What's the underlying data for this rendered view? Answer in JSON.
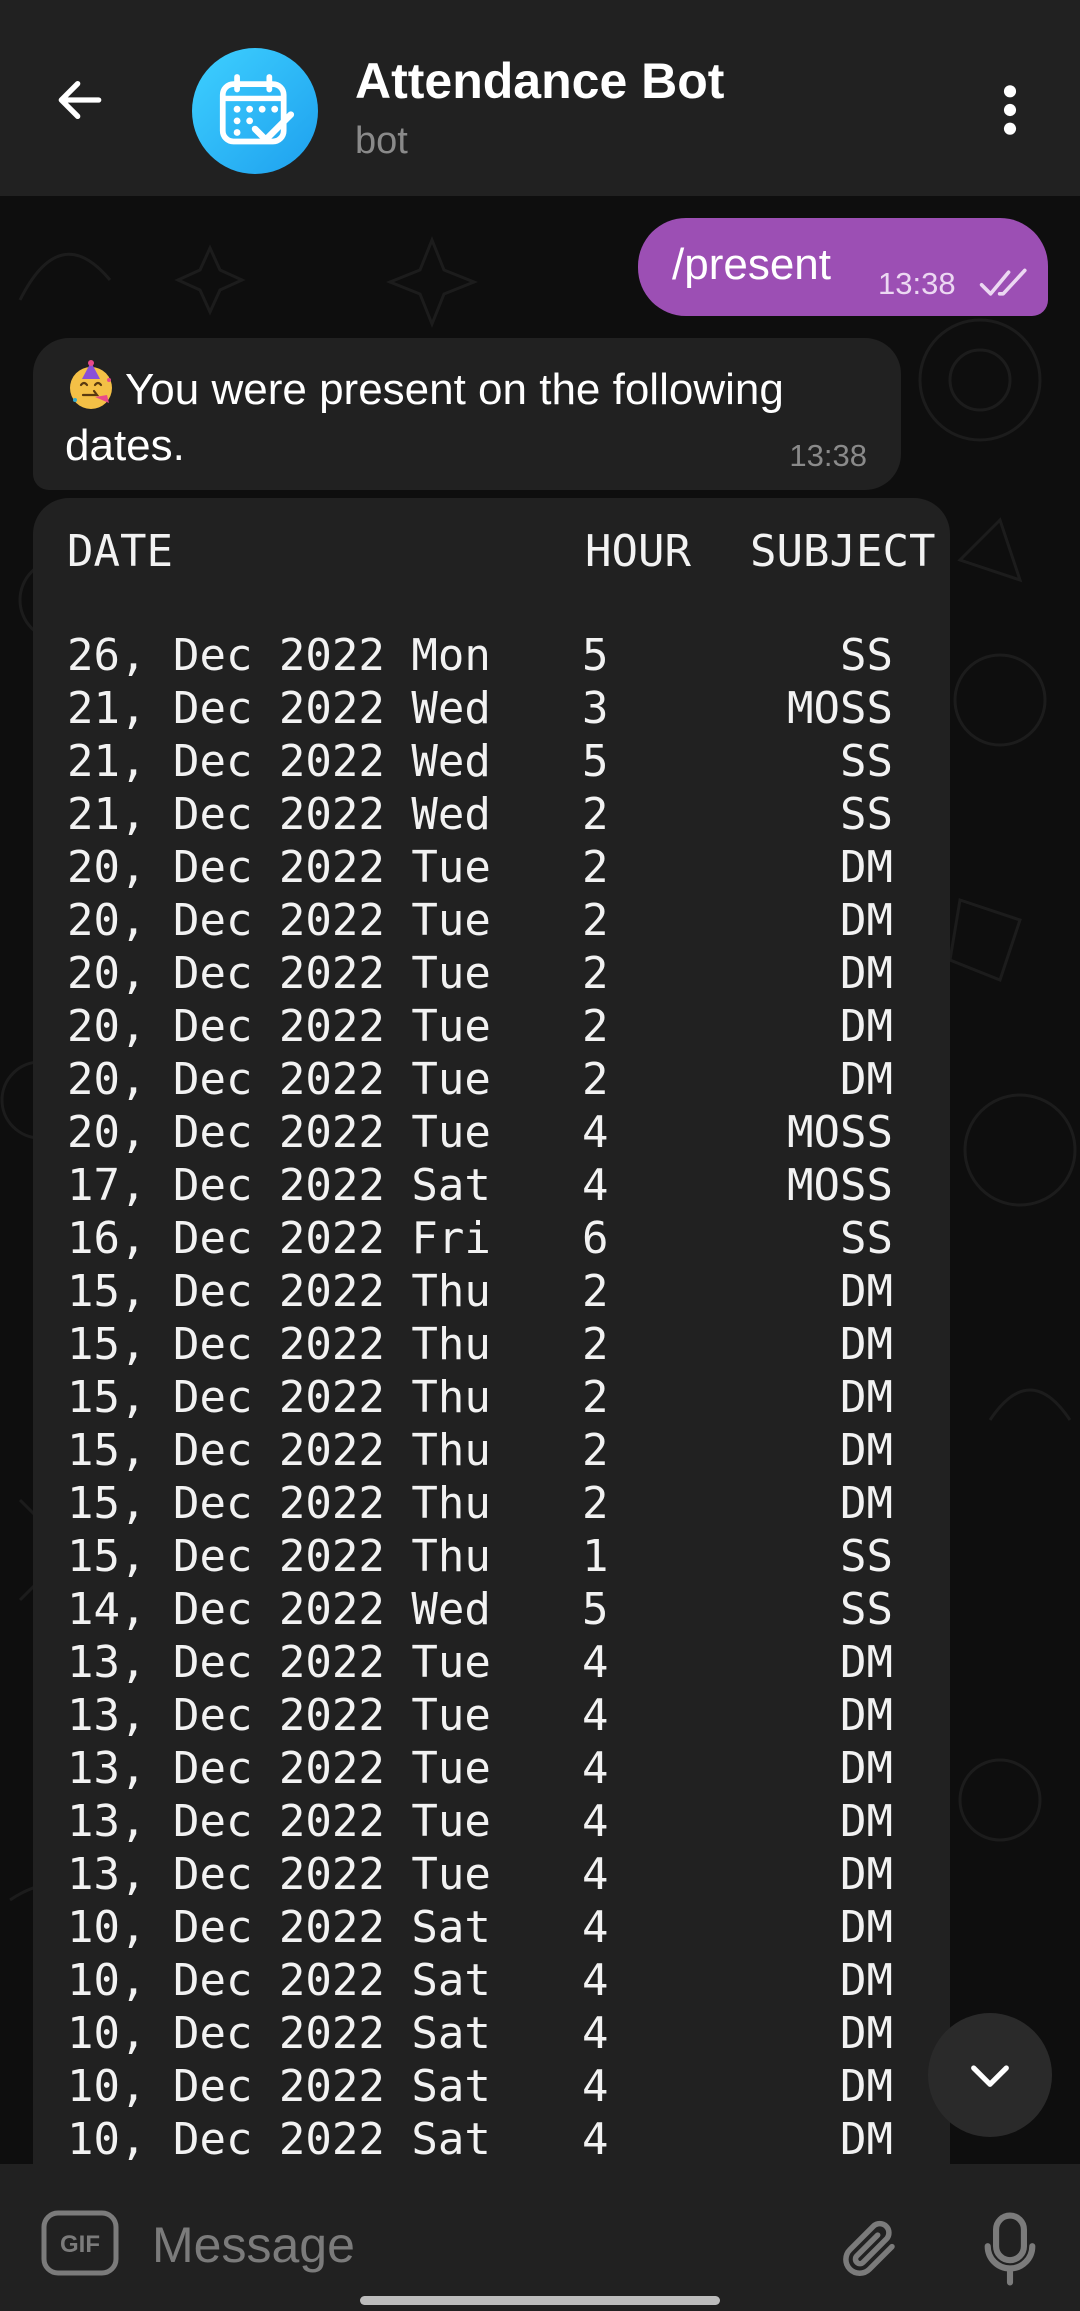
{
  "header": {
    "title": "Attendance Bot",
    "subtitle": "bot",
    "back_icon": "arrow-left-icon",
    "avatar_icon": "calendar-check-icon",
    "menu_icon": "more-vertical-icon"
  },
  "messages": {
    "outgoing": {
      "text": "/present",
      "time": "13:38",
      "status_icon": "double-check-icon"
    },
    "incoming": {
      "emoji": "partying-face-emoji",
      "text": "You were present on the following dates.",
      "time": "13:38"
    }
  },
  "table": {
    "headers": {
      "date": "DATE",
      "hour": "HOUR",
      "subject": "SUBJECT"
    },
    "rows": [
      [
        "26, Dec 2022 Mon",
        "5",
        "SS"
      ],
      [
        "21, Dec 2022 Wed",
        "3",
        "MOSS"
      ],
      [
        "21, Dec 2022 Wed",
        "5",
        "SS"
      ],
      [
        "21, Dec 2022 Wed",
        "2",
        "SS"
      ],
      [
        "20, Dec 2022 Tue",
        "2",
        "DM"
      ],
      [
        "20, Dec 2022 Tue",
        "2",
        "DM"
      ],
      [
        "20, Dec 2022 Tue",
        "2",
        "DM"
      ],
      [
        "20, Dec 2022 Tue",
        "2",
        "DM"
      ],
      [
        "20, Dec 2022 Tue",
        "2",
        "DM"
      ],
      [
        "20, Dec 2022 Tue",
        "4",
        "MOSS"
      ],
      [
        "17, Dec 2022 Sat",
        "4",
        "MOSS"
      ],
      [
        "16, Dec 2022 Fri",
        "6",
        "SS"
      ],
      [
        "15, Dec 2022 Thu",
        "2",
        "DM"
      ],
      [
        "15, Dec 2022 Thu",
        "2",
        "DM"
      ],
      [
        "15, Dec 2022 Thu",
        "2",
        "DM"
      ],
      [
        "15, Dec 2022 Thu",
        "2",
        "DM"
      ],
      [
        "15, Dec 2022 Thu",
        "2",
        "DM"
      ],
      [
        "15, Dec 2022 Thu",
        "1",
        "SS"
      ],
      [
        "14, Dec 2022 Wed",
        "5",
        "SS"
      ],
      [
        "13, Dec 2022 Tue",
        "4",
        "DM"
      ],
      [
        "13, Dec 2022 Tue",
        "4",
        "DM"
      ],
      [
        "13, Dec 2022 Tue",
        "4",
        "DM"
      ],
      [
        "13, Dec 2022 Tue",
        "4",
        "DM"
      ],
      [
        "13, Dec 2022 Tue",
        "4",
        "DM"
      ],
      [
        "10, Dec 2022 Sat",
        "4",
        "DM"
      ],
      [
        "10, Dec 2022 Sat",
        "4",
        "DM"
      ],
      [
        "10, Dec 2022 Sat",
        "4",
        "DM"
      ],
      [
        "10, Dec 2022 Sat",
        "4",
        "DM"
      ],
      [
        "10, Dec 2022 Sat",
        "4",
        "DM"
      ]
    ]
  },
  "input": {
    "placeholder": "Message",
    "gif_icon": "gif-icon",
    "attach_icon": "paperclip-icon",
    "mic_icon": "microphone-icon"
  },
  "scroll_icon": "chevron-down-icon",
  "colors": {
    "background": "#0e0e0e",
    "bar": "#212121",
    "outgoing_bubble": "#9c4fb4",
    "incoming_bubble": "#212121",
    "avatar": "#1ea0ee",
    "secondary_text": "#8a8a8a"
  }
}
